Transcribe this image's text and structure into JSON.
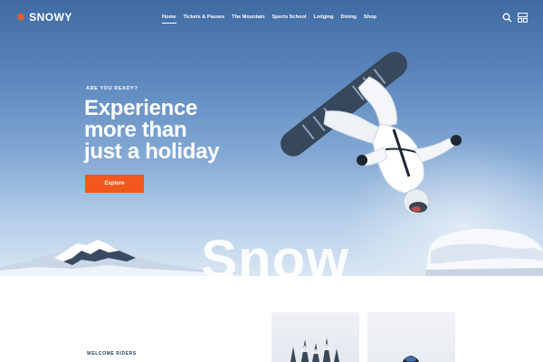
{
  "brand": {
    "name": "SNOWY",
    "icon": "snowflake-icon",
    "accent": "#f2581c"
  },
  "nav": {
    "items": [
      {
        "label": "Home",
        "active": true
      },
      {
        "label": "Tickets & Passes"
      },
      {
        "label": "The Mountain"
      },
      {
        "label": "Sports School"
      },
      {
        "label": "Lodging"
      },
      {
        "label": "Dining"
      },
      {
        "label": "Shop"
      }
    ]
  },
  "header_icons": {
    "search": "search-icon",
    "menu": "grid-menu-icon"
  },
  "hero": {
    "eyebrow": "ARE YOU READY?",
    "headline": [
      "Experience",
      "more than",
      "just a holiday"
    ],
    "cta": "Explore",
    "watermark": "Snow"
  },
  "intro": {
    "eyebrow": "WELCOME RIDERS"
  }
}
